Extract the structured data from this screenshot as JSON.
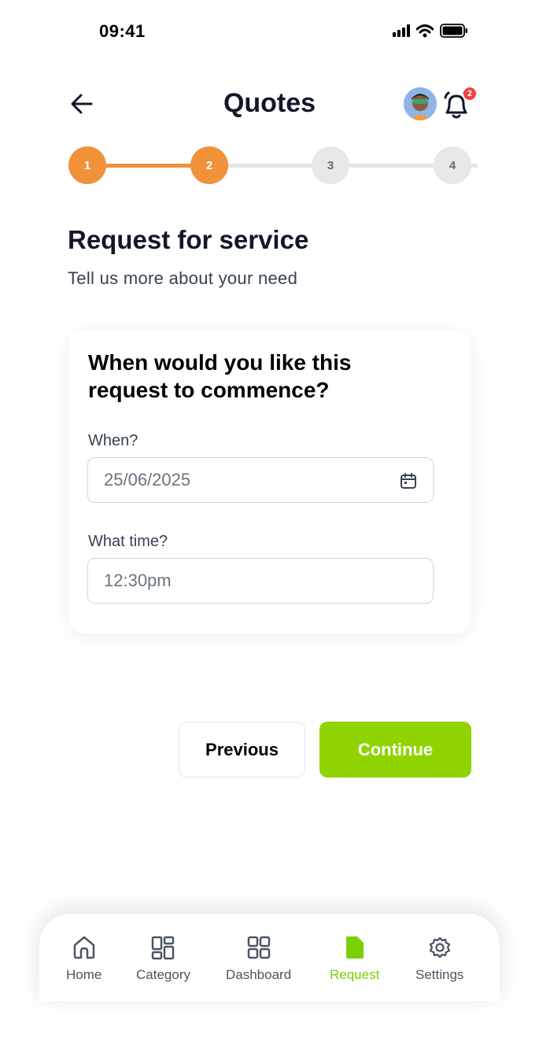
{
  "status_bar": {
    "time": "09:41"
  },
  "header": {
    "title": "Quotes",
    "notification_count": "2"
  },
  "stepper": {
    "current_step": 2,
    "steps": [
      {
        "label": "1",
        "state": "active"
      },
      {
        "label": "2",
        "state": "active"
      },
      {
        "label": "3",
        "state": "inactive"
      },
      {
        "label": "4",
        "state": "inactive"
      }
    ]
  },
  "section": {
    "title": "Request for service",
    "subtitle": "Tell us more about your need"
  },
  "card": {
    "question": "When would you like this request to commence?",
    "when_label": "When?",
    "when_value": "25/06/2025",
    "time_label": "What time?",
    "time_value": "12:30pm"
  },
  "actions": {
    "previous_label": "Previous",
    "continue_label": "Continue"
  },
  "bottom_nav": {
    "items": [
      {
        "label": "Home",
        "icon": "home-icon",
        "active": false
      },
      {
        "label": "Category",
        "icon": "category-icon",
        "active": false
      },
      {
        "label": "Dashboard",
        "icon": "dashboard-icon",
        "active": false
      },
      {
        "label": "Request",
        "icon": "request-icon",
        "active": true
      },
      {
        "label": "Settings",
        "icon": "settings-icon",
        "active": false
      }
    ]
  },
  "colors": {
    "accent_orange": "#f0923a",
    "accent_green": "#8fd400",
    "active_nav": "#7ccf00",
    "badge_red": "#ef4444"
  }
}
